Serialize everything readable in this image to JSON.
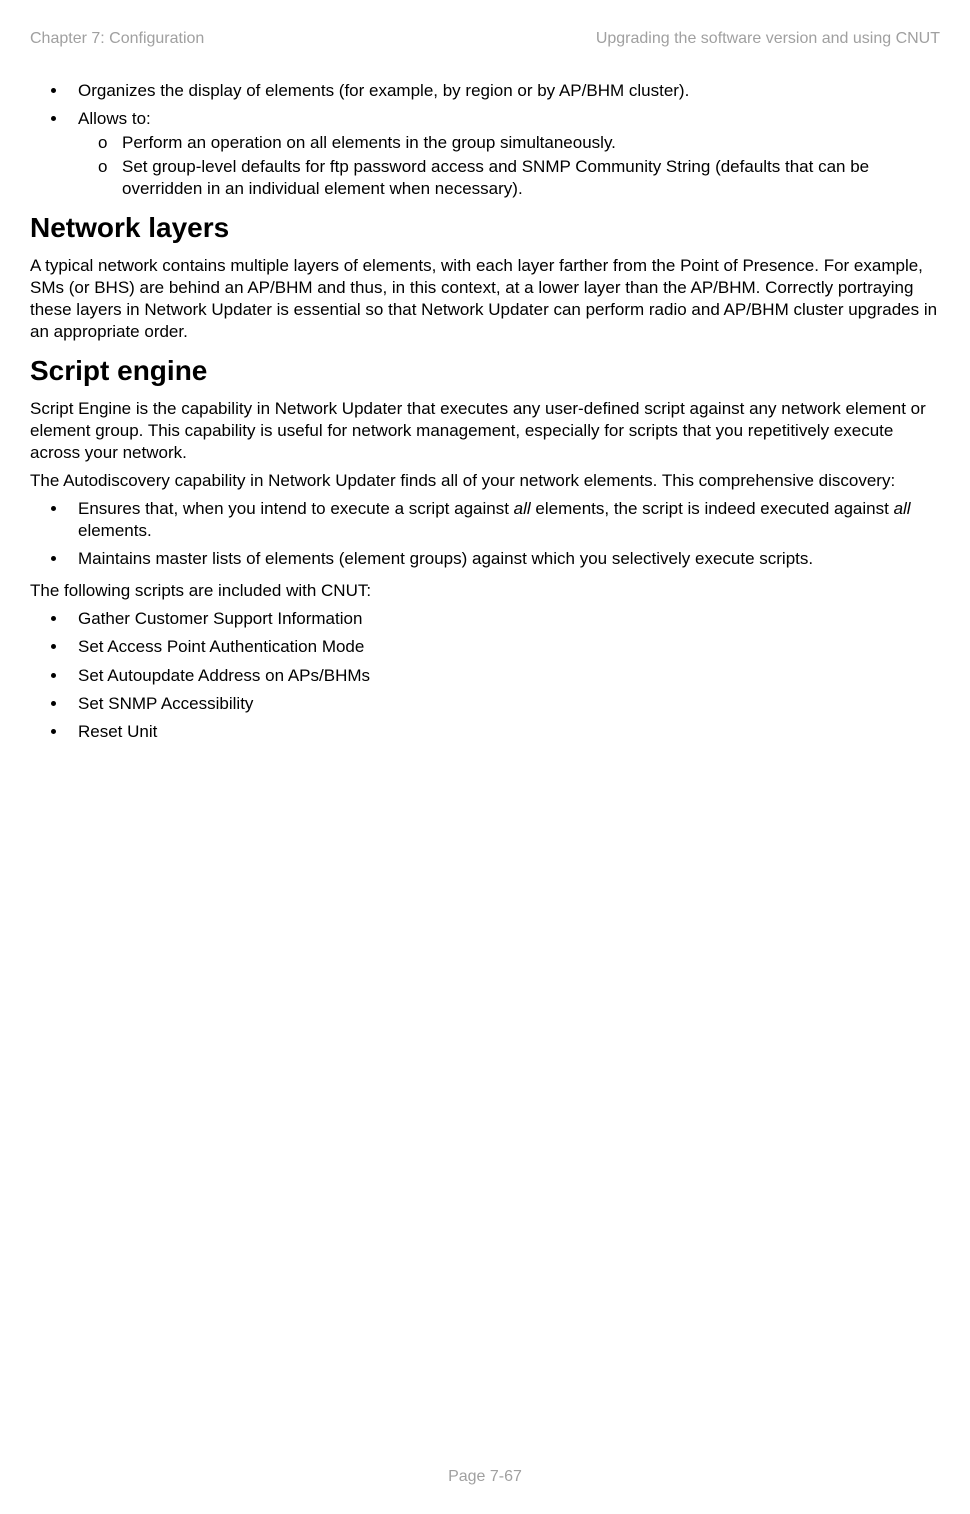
{
  "header": {
    "left": "Chapter 7:  Configuration",
    "right": "Upgrading the software version and using CNUT"
  },
  "section1": {
    "bullets": [
      "Organizes the display of elements (for example, by region or by AP/BHM cluster).",
      "Allows to:"
    ],
    "subbullets": [
      "Perform an operation on all elements in the group simultaneously.",
      "Set group-level defaults for ftp password access and SNMP Community String (defaults that can be overridden in an individual element when necessary)."
    ]
  },
  "section2": {
    "heading": "Network layers",
    "paragraph": "A typical network contains multiple layers of elements, with each layer farther from the Point of Presence. For example, SMs (or BHS) are behind an AP/BHM and thus, in this context, at a lower layer than the AP/BHM. Correctly portraying these layers in Network Updater is essential so that Network Updater can perform radio and AP/BHM cluster upgrades in an appropriate order."
  },
  "section3": {
    "heading": "Script engine",
    "para1": "Script Engine is the capability in Network Updater that executes any user-defined script against any network element or element group. This capability is useful for network management, especially for scripts that you repetitively execute across your network.",
    "para2": "The Autodiscovery capability in Network Updater finds all of your network elements. This comprehensive discovery:",
    "bullets1_pre": "Ensures that, when you intend to execute a script against ",
    "bullets1_italic1": "all",
    "bullets1_mid": " elements, the script is indeed executed against ",
    "bullets1_italic2": "all",
    "bullets1_post": " elements.",
    "bullets1_item2": "Maintains master lists of elements (element groups) against which you selectively execute scripts.",
    "para3": "The following scripts are included with CNUT:",
    "bullets2": [
      "Gather Customer Support Information",
      "Set Access Point Authentication Mode",
      "Set Autoupdate Address on APs/BHMs",
      "Set SNMP Accessibility",
      "Reset Unit"
    ]
  },
  "footer": "Page 7-67",
  "sub_marker": "o"
}
